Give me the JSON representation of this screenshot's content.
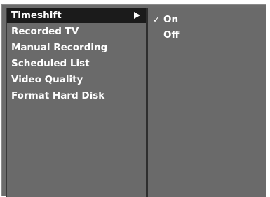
{
  "menu": {
    "items": [
      {
        "label": "Timeshift",
        "selected": true,
        "has_submenu": true,
        "arrow_icon": "arrow-right-icon"
      },
      {
        "label": "Recorded TV",
        "selected": false
      },
      {
        "label": "Manual Recording",
        "selected": false
      },
      {
        "label": "Scheduled List",
        "selected": false
      },
      {
        "label": "Video Quality",
        "selected": false
      },
      {
        "label": "Format Hard Disk",
        "selected": false
      }
    ]
  },
  "submenu": {
    "check_glyph": "✓",
    "options": [
      {
        "label": "On",
        "checked": true
      },
      {
        "label": "Off",
        "checked": false
      }
    ]
  },
  "colors": {
    "panel_background": "#6a6a6a",
    "selected_background": "#1b1b1b",
    "text": "#ffffff"
  }
}
